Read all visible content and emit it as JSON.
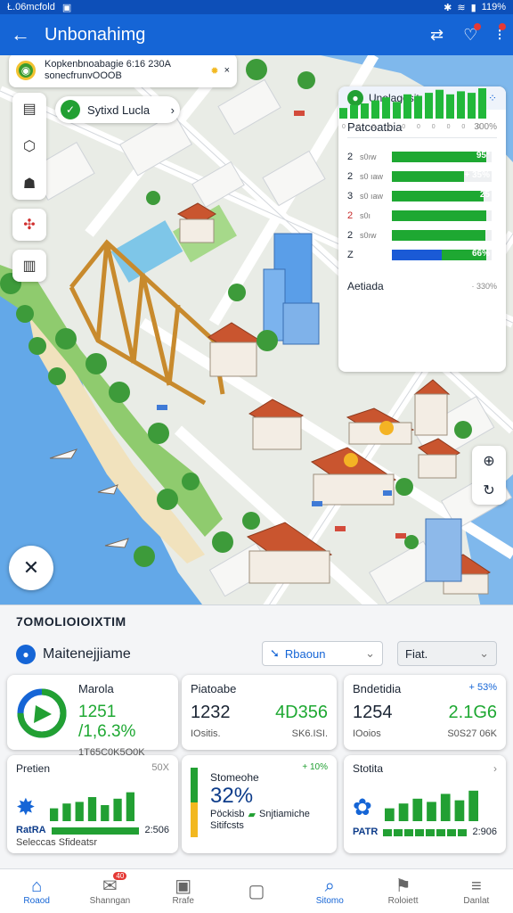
{
  "status_bar": {
    "time": "Ł.06mcfold",
    "battery": "119%"
  },
  "app_bar": {
    "title": "Unbonahimg"
  },
  "notification": {
    "line1": "Kopkenbnoabagie 6:16 230A",
    "line2": "sonecfrunvOOOB"
  },
  "pill": {
    "label": "Sytixd Lucla"
  },
  "panel": {
    "title": "Unolagesit",
    "section1": {
      "title": "Patcoatbia",
      "value": "300%"
    },
    "rows": [
      {
        "num": "2",
        "label": "s0ıw",
        "value": "95°",
        "fill": 0.95,
        "color": "#1ea832"
      },
      {
        "num": "2",
        "label": "s0 ıaw",
        "value": "+ 35%",
        "fill": 0.72,
        "color": "#1ea832"
      },
      {
        "num": "3",
        "label": "s0 ıaw",
        "value": "25",
        "fill": 0.92,
        "color": "#1ea832"
      },
      {
        "num": "2",
        "label": "s0ı",
        "value": "",
        "fill": 0.95,
        "color": "#1ea832"
      },
      {
        "num": "2",
        "label": "s0ıw",
        "value": "",
        "fill": 0.94,
        "color": "#1ea832"
      },
      {
        "num": "Z",
        "label": "",
        "value": "66%",
        "fill": 0.5,
        "color": "#1a5ad6",
        "fill2": 0.95
      }
    ],
    "section2": {
      "title": "Aetiada",
      "value": "· 330%"
    },
    "spark": [
      0.35,
      0.45,
      0.5,
      0.6,
      0.7,
      0.55,
      0.8,
      0.75,
      0.85,
      0.95,
      0.8,
      0.9,
      0.85,
      1.0
    ],
    "spark_labels": [
      "0",
      "0",
      "0",
      "0",
      "0",
      "0",
      "0",
      "0",
      "0",
      "0"
    ]
  },
  "bottom": {
    "heading": "7OMOLIOIOIXTIM",
    "subtitle": "Maitenejjiame",
    "select1": "Rbaoun",
    "select2": "Fiat.",
    "stats": [
      {
        "label": "Marola",
        "big": "1251 /1,6.3%",
        "small": "1T65C0K5O0K",
        "ring": 0.75
      },
      {
        "label": "Piatoabe",
        "big1": "1232",
        "big2": "4D356",
        "small1": "IOsitis.",
        "small2": "SK6.ISI."
      },
      {
        "label": "Bndetidia",
        "delta": "+ 53%",
        "big1": "1254",
        "big2": "2.1G6",
        "small1": "IOoios",
        "small2": "S0S27 06K"
      }
    ],
    "minis": [
      {
        "label": "Pretien",
        "right": "50X",
        "bars": [
          0.4,
          0.55,
          0.6,
          0.75,
          0.5,
          0.7,
          0.9
        ],
        "foot_label": "RatRA",
        "foot_value": "2:506",
        "foot_text": "Seleccas Sfideatsr"
      },
      {
        "label": "Stomeohe",
        "right": "+ 10%",
        "big": "32%",
        "line1": "Pöckisb",
        "line2": "Snjtiamiche",
        "line3": "Sitifcsts"
      },
      {
        "label": "Stotita",
        "right": "›",
        "bars": [
          0.4,
          0.55,
          0.7,
          0.6,
          0.85,
          0.65,
          0.95
        ],
        "foot_label": "PATR",
        "foot_value": "2:906"
      }
    ]
  },
  "nav": [
    {
      "label": "Roaod",
      "icon": "home-icon",
      "glyph": "⌂",
      "active": true
    },
    {
      "label": "Shanngan",
      "icon": "shop-icon",
      "glyph": "✉",
      "count": "40"
    },
    {
      "label": "Rrafe",
      "icon": "map-icon",
      "glyph": "▣"
    },
    {
      "label": "",
      "icon": "note-icon",
      "glyph": "▢"
    },
    {
      "label": "Sitomo",
      "icon": "search-icon",
      "glyph": "⌕",
      "active": true
    },
    {
      "label": "Roloiett",
      "icon": "flag-icon",
      "glyph": "⚑"
    },
    {
      "label": "Danlat",
      "icon": "menu-icon",
      "glyph": "≡"
    }
  ],
  "colors": {
    "primary": "#1565d6",
    "green": "#1ea832",
    "water": "#63a8e8"
  }
}
